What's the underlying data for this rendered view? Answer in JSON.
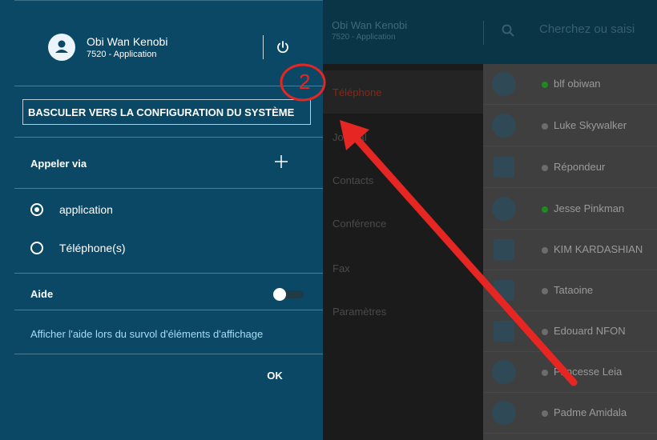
{
  "header": {
    "user_name": "Obi Wan Kenobi",
    "user_subtitle": "7520 - Application",
    "search_placeholder": "Cherchez ou saisi"
  },
  "nav": {
    "items": [
      {
        "label": "Téléphone",
        "active": true
      },
      {
        "label": "Journal",
        "active": false
      },
      {
        "label": "Contacts",
        "active": false
      },
      {
        "label": "Conférence",
        "active": false
      },
      {
        "label": "Fax",
        "active": false
      },
      {
        "label": "Paramètres",
        "active": false
      }
    ]
  },
  "contacts": [
    {
      "name": "blf obiwan",
      "status": "green",
      "icon": "person-icon"
    },
    {
      "name": "Luke Skywalker",
      "status": "grey",
      "icon": "person-icon"
    },
    {
      "name": "Répondeur",
      "status": "grey",
      "icon": "voicemail-icon"
    },
    {
      "name": "Jesse Pinkman",
      "status": "green",
      "icon": "person-icon"
    },
    {
      "name": "KIM KARDASHIAN",
      "status": "grey",
      "icon": "phone-device-icon"
    },
    {
      "name": "Tataoine",
      "status": "grey",
      "icon": "phone-device-icon"
    },
    {
      "name": "Edouard NFON",
      "status": "grey",
      "icon": "phone-device-icon"
    },
    {
      "name": "Princesse Leia",
      "status": "grey",
      "icon": "person-icon"
    },
    {
      "name": "Padme Amidala",
      "status": "grey",
      "icon": "person-icon"
    }
  ],
  "drawer": {
    "user_name": "Obi Wan Kenobi",
    "user_subtitle": "7520 - Application",
    "switch_button": "BASCULER VERS LA CONFIGURATION DU SYSTÈME",
    "call_via_title": "Appeler via",
    "radio_options": [
      {
        "label": "application",
        "checked": true
      },
      {
        "label": "Téléphone(s)",
        "checked": false
      }
    ],
    "help_title": "Aide",
    "help_toggle_on": false,
    "help_link": "Afficher l'aide lors du survol d'éléments d'affichage",
    "ok_label": "OK"
  },
  "annotation": {
    "step_number": "2",
    "color": "#e52622"
  },
  "colors": {
    "drawer_bg": "#0a4866",
    "header_bg": "#093547",
    "status_online": "#1d8a1d",
    "accent_link": "#a9dcf2"
  }
}
